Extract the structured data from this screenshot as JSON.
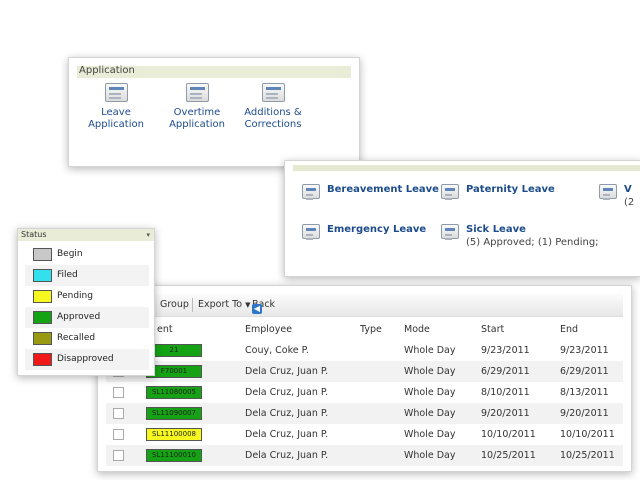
{
  "application": {
    "header": "Application",
    "items": [
      {
        "line1": "Leave",
        "line2": "Application"
      },
      {
        "line1": "Overtime",
        "line2": "Application"
      },
      {
        "line1": "Additions &",
        "line2": "Corrections"
      }
    ]
  },
  "leave_types": {
    "items": [
      {
        "name": "Bereavement Leave",
        "detail": ""
      },
      {
        "name": "Paternity Leave",
        "detail": ""
      },
      {
        "name": "V",
        "detail": "(2"
      },
      {
        "name": "Emergency Leave",
        "detail": ""
      },
      {
        "name": "Sick Leave",
        "detail": "(5) Approved; (1) Pending;"
      }
    ]
  },
  "status_legend": {
    "header": "Status",
    "items": [
      {
        "label": "Begin",
        "color": "#c8c8c8"
      },
      {
        "label": "Filed",
        "color": "#33e0ee"
      },
      {
        "label": "Pending",
        "color": "#f7f720"
      },
      {
        "label": "Approved",
        "color": "#15a315"
      },
      {
        "label": "Recalled",
        "color": "#999912"
      },
      {
        "label": "Disapproved",
        "color": "#f01818"
      }
    ]
  },
  "table": {
    "toolbar": {
      "group": "Group",
      "export": "Export To",
      "back": "Back"
    },
    "columns": [
      "ent",
      "Employee",
      "Type",
      "Mode",
      "Start",
      "End"
    ],
    "rows": [
      {
        "document": "21",
        "employee": "Couy, Coke P.",
        "type": "",
        "mode": "Whole Day",
        "start": "9/23/2011",
        "end": "9/23/2011",
        "status_color": "#15a315"
      },
      {
        "document": "F70001",
        "employee": "Dela Cruz, Juan P.",
        "type": "",
        "mode": "Whole Day",
        "start": "6/29/2011",
        "end": "6/29/2011",
        "status_color": "#15a315"
      },
      {
        "document": "SL11080005",
        "employee": "Dela Cruz, Juan P.",
        "type": "",
        "mode": "Whole Day",
        "start": "8/10/2011",
        "end": "8/13/2011",
        "status_color": "#15a315"
      },
      {
        "document": "SL11090007",
        "employee": "Dela Cruz, Juan P.",
        "type": "",
        "mode": "Whole Day",
        "start": "9/20/2011",
        "end": "9/20/2011",
        "status_color": "#15a315"
      },
      {
        "document": "SL11100008",
        "employee": "Dela Cruz, Juan P.",
        "type": "",
        "mode": "Whole Day",
        "start": "10/10/2011",
        "end": "10/10/2011",
        "status_color": "#f7f720"
      },
      {
        "document": "SL11100010",
        "employee": "Dela Cruz, Juan P.",
        "type": "",
        "mode": "Whole Day",
        "start": "10/25/2011",
        "end": "10/25/2011",
        "status_color": "#15a315"
      }
    ]
  }
}
